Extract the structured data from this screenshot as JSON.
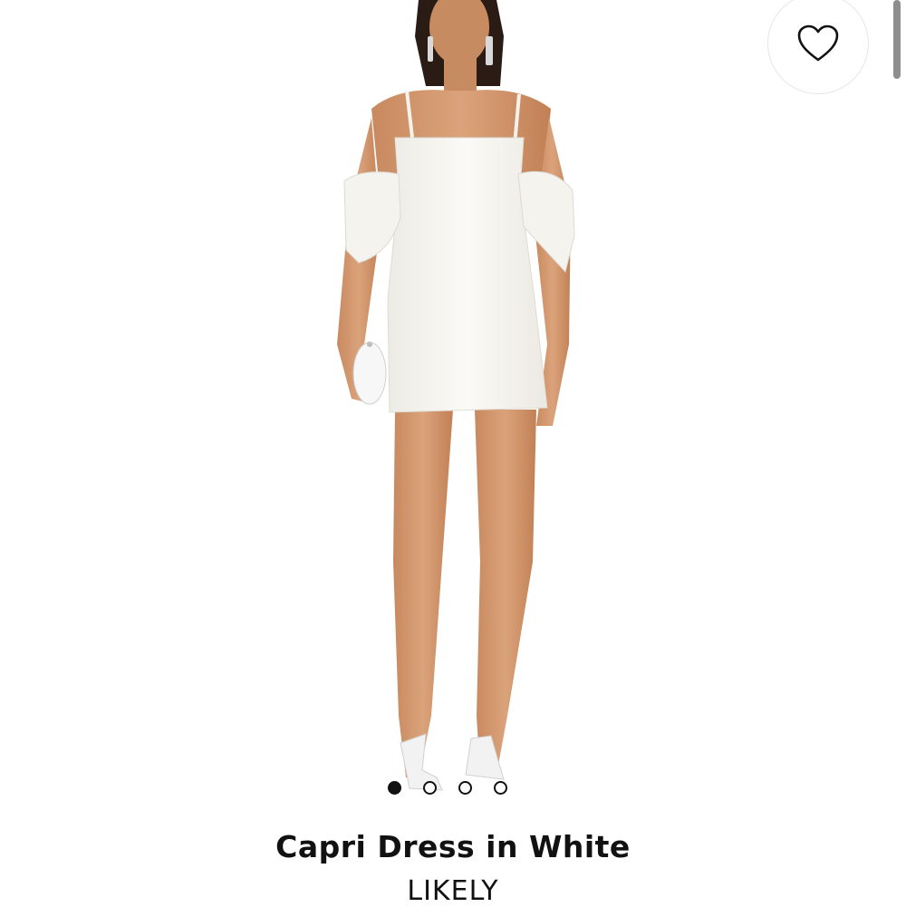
{
  "product": {
    "title": "Capri Dress in White",
    "brand": "LIKELY"
  },
  "icons": {
    "wishlist": "heart-outline-icon",
    "image": "model-in-white-dress-photo"
  },
  "carousel": {
    "total_images": 4,
    "active_index": 0
  },
  "colors": {
    "text": "#111111",
    "background": "#ffffff"
  }
}
